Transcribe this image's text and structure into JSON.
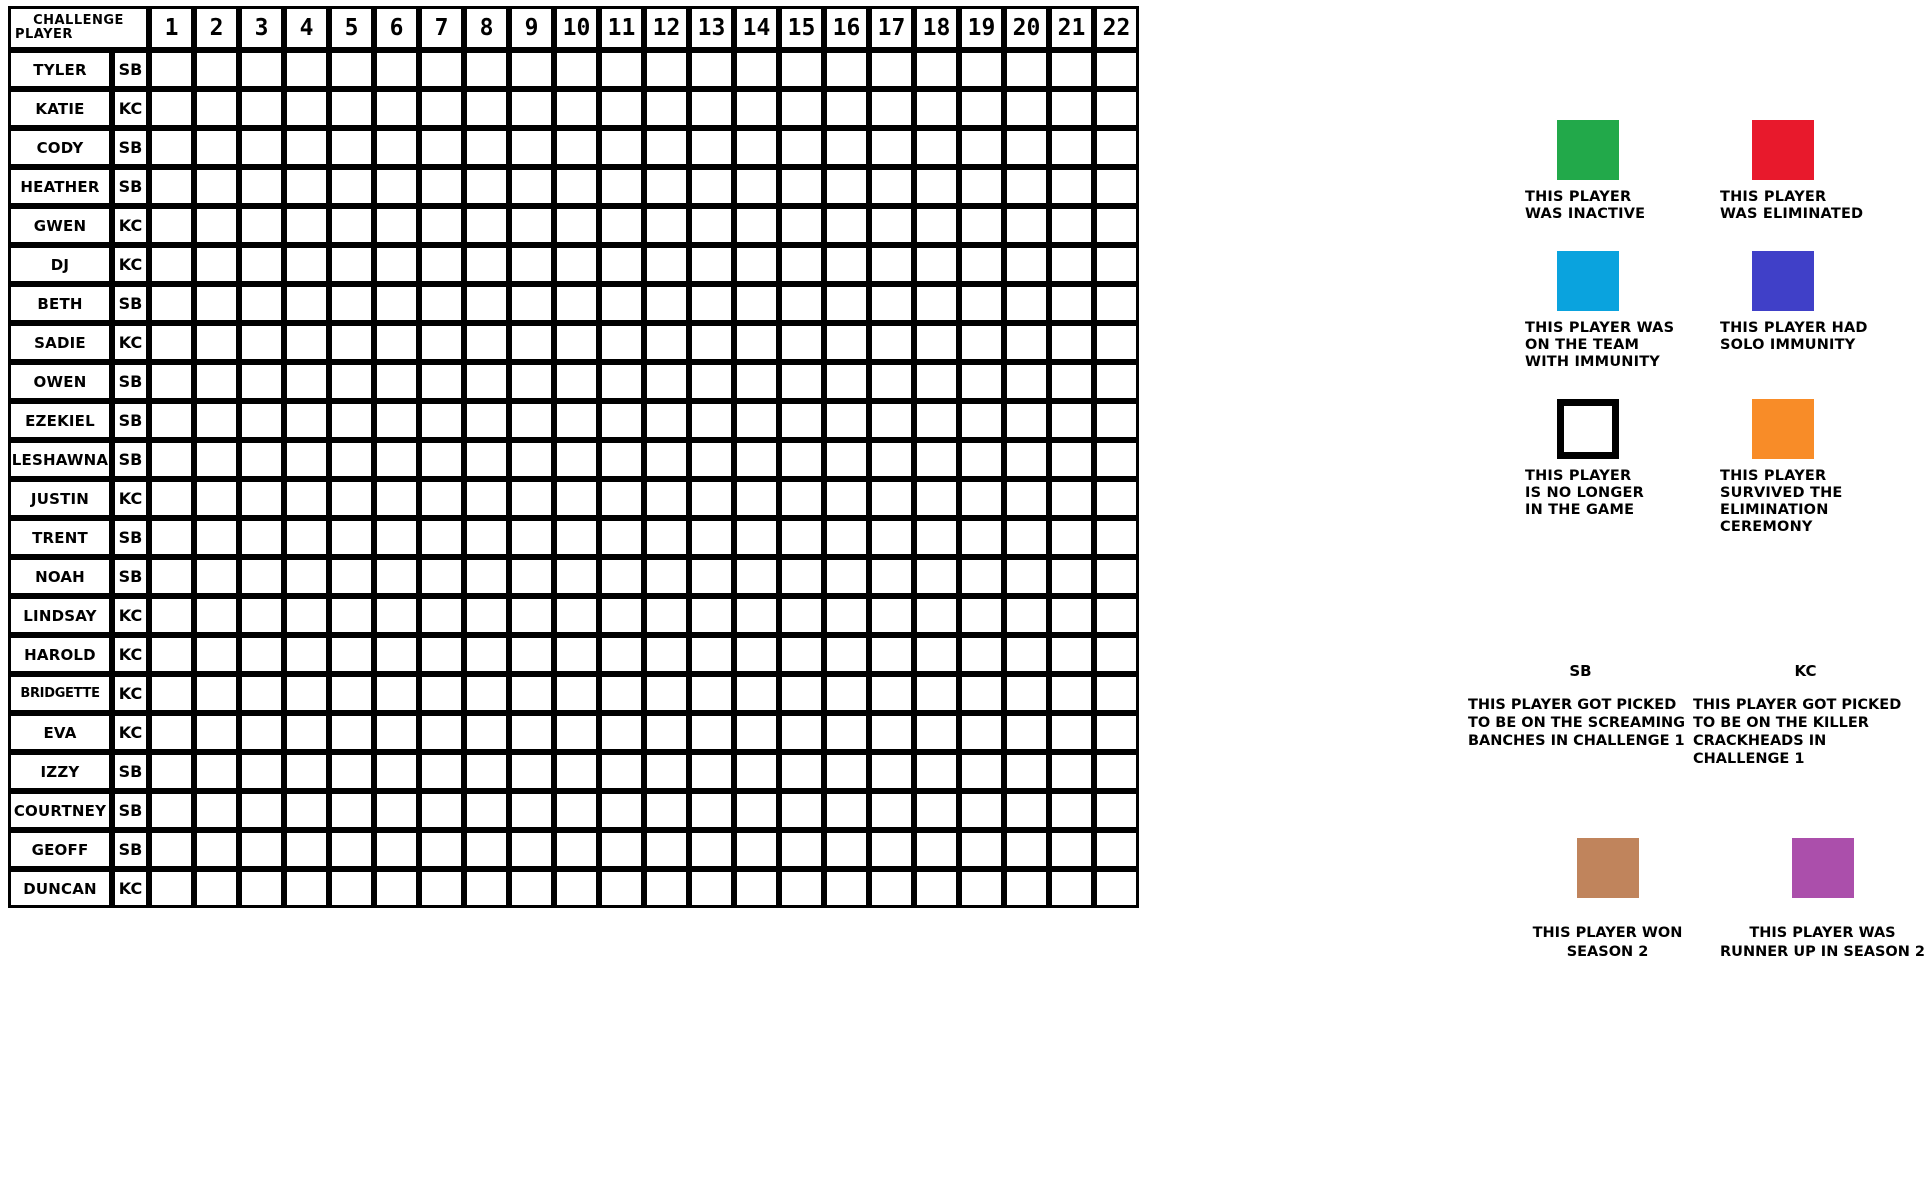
{
  "table": {
    "corner_label_line1": "CHALLENGE",
    "corner_label_line2": "PLAYER",
    "columns": [
      "1",
      "2",
      "3",
      "4",
      "5",
      "6",
      "7",
      "8",
      "9",
      "10",
      "11",
      "12",
      "13",
      "14",
      "15",
      "16",
      "17",
      "18",
      "19",
      "20",
      "21",
      "22"
    ],
    "rows": [
      {
        "player": "TYLER",
        "team": "SB",
        "cells": [
          "team",
          "surv",
          "elim",
          "blank",
          "blank",
          "blank",
          "blank",
          "blank",
          "blank",
          "blank",
          "blank",
          "blank",
          "blank",
          "blank",
          "blank",
          "blank",
          "blank",
          "blank",
          "blank",
          "blank",
          "blank",
          "blank"
        ]
      },
      {
        "player": "KATIE",
        "team": "KC",
        "cells": [
          "surv",
          "team",
          "team",
          "elim",
          "blank",
          "blank",
          "blank",
          "blank",
          "blank",
          "blank",
          "blank",
          "blank",
          "blank",
          "blank",
          "blank",
          "blank",
          "blank",
          "blank",
          "blank",
          "blank",
          "blank",
          "blank"
        ]
      },
      {
        "player": "CODY",
        "team": "SB",
        "cells": [
          "team",
          "surv",
          "surv",
          "team",
          "elim",
          "blank",
          "blank",
          "blank",
          "blank",
          "blank",
          "blank",
          "blank",
          "blank",
          "blank",
          "blank",
          "blank",
          "blank",
          "blank",
          "blank",
          "blank",
          "blank",
          "blank"
        ]
      },
      {
        "player": "HEATHER",
        "team": "SB",
        "cells": [
          "team",
          "surv",
          "surv",
          "team",
          "surv",
          "elim",
          "blank",
          "blank",
          "blank",
          "blank",
          "blank",
          "blank",
          "blank",
          "blank",
          "blank",
          "blank",
          "blank",
          "blank",
          "blank",
          "blank",
          "blank",
          "blank"
        ]
      },
      {
        "player": "GWEN",
        "team": "KC",
        "cells": [
          "surv",
          "team",
          "team",
          "surv",
          "team",
          "team",
          "elim",
          "blank",
          "blank",
          "blank",
          "blank",
          "blank",
          "blank",
          "blank",
          "blank",
          "blank",
          "blank",
          "blank",
          "blank",
          "blank",
          "blank",
          "blank"
        ]
      },
      {
        "player": "DJ",
        "team": "KC",
        "cells": [
          "surv",
          "team",
          "team",
          "surv",
          "team",
          "team",
          "surv",
          "team",
          "team",
          "elim",
          "blank",
          "blank",
          "blank",
          "blank",
          "blank",
          "blank",
          "blank",
          "blank",
          "blank",
          "blank",
          "blank",
          "blank"
        ]
      },
      {
        "player": "BETH",
        "team": "SB",
        "cells": [
          "team",
          "surv",
          "surv",
          "team",
          "surv",
          "surv",
          "team",
          "surv",
          "surv",
          "team",
          "elim",
          "blank",
          "blank",
          "blank",
          "blank",
          "blank",
          "blank",
          "blank",
          "blank",
          "blank",
          "blank",
          "blank"
        ]
      },
      {
        "player": "SADIE",
        "team": "KC",
        "cells": [
          "surv",
          "team",
          "team",
          "surv",
          "team",
          "team",
          "surv",
          "team",
          "team",
          "surv",
          "team",
          "elim",
          "blank",
          "blank",
          "blank",
          "blank",
          "blank",
          "blank",
          "blank",
          "blank",
          "blank",
          "blank"
        ]
      },
      {
        "player": "OWEN",
        "team": "SB",
        "cells": [
          "team",
          "surv",
          "surv",
          "team",
          "surv",
          "surv",
          "team",
          "surv",
          "surv",
          "team",
          "surv",
          "surv",
          "elim",
          "blank",
          "blank",
          "blank",
          "blank",
          "blank",
          "blank",
          "blank",
          "blank",
          "blank"
        ]
      },
      {
        "player": "EZEKIEL",
        "team": "SB",
        "cells": [
          "team",
          "surv",
          "surv",
          "team",
          "surv",
          "surv",
          "team",
          "surv",
          "surv",
          "team",
          "surv",
          "surv",
          "elim",
          "blank",
          "blank",
          "blank",
          "blank",
          "blank",
          "blank",
          "blank",
          "blank",
          "blank"
        ]
      },
      {
        "player": "LESHAWNA",
        "team": "SB",
        "cells": [
          "team",
          "surv",
          "surv",
          "team",
          "surv",
          "surv",
          "team",
          "surv",
          "surv",
          "team",
          "surv",
          "surv",
          "surv",
          "elim",
          "blank",
          "blank",
          "blank",
          "blank",
          "blank",
          "blank",
          "blank",
          "blank"
        ]
      },
      {
        "player": "JUSTIN",
        "team": "KC",
        "cells": [
          "surv",
          "team",
          "team",
          "surv",
          "team",
          "team",
          "surv",
          "team",
          "team",
          "surv",
          "team",
          "surv",
          "surv",
          "elim",
          "blank",
          "blank",
          "blank",
          "blank",
          "blank",
          "blank",
          "blank",
          "blank"
        ]
      },
      {
        "player": "TRENT",
        "team": "SB",
        "cells": [
          "team",
          "surv",
          "surv",
          "team",
          "surv",
          "surv",
          "team",
          "surv",
          "surv",
          "team",
          "surv",
          "surv",
          "surv",
          "surv",
          "elim",
          "blank",
          "blank",
          "blank",
          "blank",
          "blank",
          "blank",
          "blank"
        ]
      },
      {
        "player": "NOAH",
        "team": "SB",
        "cells": [
          "team",
          "surv",
          "surv",
          "team",
          "surv",
          "surv",
          "team",
          "surv",
          "surv",
          "team",
          "surv",
          "surv",
          "solo",
          "surv",
          "surv",
          "elim",
          "blank",
          "blank",
          "blank",
          "blank",
          "blank",
          "blank"
        ]
      },
      {
        "player": "LINDSAY",
        "team": "KC",
        "cells": [
          "surv",
          "team",
          "team",
          "surv",
          "team",
          "team",
          "surv",
          "team",
          "team",
          "surv",
          "team",
          "surv",
          "surv",
          "surv",
          "surv",
          "solo",
          "elim",
          "blank",
          "blank",
          "blank",
          "blank",
          "blank"
        ]
      },
      {
        "player": "HAROLD",
        "team": "KC",
        "cells": [
          "surv",
          "team",
          "team",
          "surv",
          "team",
          "team",
          "surv",
          "team",
          "team",
          "surv",
          "team",
          "surv",
          "surv",
          "surv",
          "surv",
          "surv",
          "elim",
          "blank",
          "blank",
          "blank",
          "blank",
          "blank"
        ]
      },
      {
        "player": "BRIDGETTE",
        "team": "KC",
        "cells": [
          "surv",
          "team",
          "team",
          "surv",
          "team",
          "team",
          "surv",
          "team",
          "team",
          "surv",
          "team",
          "surv",
          "surv",
          "surv",
          "surv",
          "surv",
          "surv",
          "elim",
          "blank",
          "blank",
          "blank",
          "blank"
        ]
      },
      {
        "player": "EVA",
        "team": "KC",
        "cells": [
          "elim",
          "inact",
          "inact",
          "inact",
          "inact",
          "inact",
          "inact",
          "inact",
          "inact",
          "inact",
          "inact",
          "solo",
          "surv",
          "surv",
          "surv",
          "surv",
          "solo",
          "elim",
          "blank",
          "blank",
          "blank",
          "blank"
        ]
      },
      {
        "player": "IZZY",
        "team": "SB",
        "cells": [
          "team",
          "elim",
          "inact",
          "inact",
          "inact",
          "inact",
          "inact",
          "inact",
          "inact",
          "inact",
          "inact",
          "inact",
          "solo",
          "surv",
          "surv",
          "surv",
          "surv",
          "surv",
          "surv",
          "elim",
          "blank",
          "blank"
        ]
      },
      {
        "player": "COURTNEY",
        "team": "SB",
        "cells": [
          "team",
          "surv",
          "surv",
          "team",
          "surv",
          "surv",
          "team",
          "elim",
          "inact",
          "inact",
          "inact",
          "inact",
          "solo",
          "surv",
          "surv",
          "surv",
          "surv",
          "surv",
          "solo",
          "surv",
          "elim",
          "blank"
        ]
      },
      {
        "player": "GEOFF",
        "team": "SB",
        "cells": [
          "team",
          "surv",
          "surv",
          "team",
          "surv",
          "surv",
          "team",
          "surv",
          "surv",
          "elim",
          "inact",
          "inact",
          "solo",
          "surv",
          "surv",
          "solo",
          "surv",
          "surv",
          "surv",
          "solo",
          "surv",
          "runner"
        ]
      },
      {
        "player": "DUNCAN",
        "team": "KC",
        "cells": [
          "surv",
          "team",
          "team",
          "surv",
          "team",
          "team",
          "surv",
          "team",
          "team",
          "surv",
          "team",
          "solo",
          "surv",
          "surv",
          "solo",
          "surv",
          "surv",
          "surv",
          "surv",
          "surv",
          "surv",
          "winner"
        ]
      }
    ]
  },
  "legend": {
    "items": [
      {
        "color_key": "inact",
        "hex": "#22a94a",
        "lines": [
          "THIS PLAYER",
          "WAS INACTIVE"
        ]
      },
      {
        "color_key": "elim",
        "hex": "#e8192c",
        "lines": [
          "THIS PLAYER",
          "WAS ELIMINATED"
        ]
      },
      {
        "color_key": "team",
        "hex": "#0aa3de",
        "lines": [
          "THIS PLAYER WAS",
          "ON THE TEAM",
          "WITH IMMUNITY"
        ]
      },
      {
        "color_key": "solo",
        "hex": "#4040c8",
        "lines": [
          "THIS PLAYER HAD",
          "SOLO IMMUNITY"
        ]
      },
      {
        "color_key": "blank",
        "hex": "#ffffff",
        "lines": [
          "THIS PLAYER",
          "IS NO LONGER",
          "IN THE GAME"
        ]
      },
      {
        "color_key": "surv",
        "hex": "#f88c28",
        "lines": [
          "THIS PLAYER",
          "SURVIVED THE",
          "ELIMINATION",
          "CEREMONY"
        ]
      }
    ],
    "teams": [
      {
        "code": "SB",
        "lines": [
          "THIS PLAYER GOT PICKED",
          "TO BE ON THE SCREAMING",
          "BANCHES IN CHALLENGE 1"
        ]
      },
      {
        "code": "KC",
        "lines": [
          "THIS PLAYER GOT PICKED",
          "TO BE ON THE KILLER",
          "CRACKHEADS IN CHALLENGE 1"
        ]
      }
    ],
    "winners": [
      {
        "color_key": "winner",
        "hex": "#c0845c",
        "lines": [
          "THIS PLAYER WON",
          "SEASON 2"
        ]
      },
      {
        "color_key": "runner",
        "hex": "#ab4fab",
        "lines": [
          "THIS PLAYER WAS",
          "RUNNER UP IN SEASON 2"
        ]
      }
    ]
  }
}
